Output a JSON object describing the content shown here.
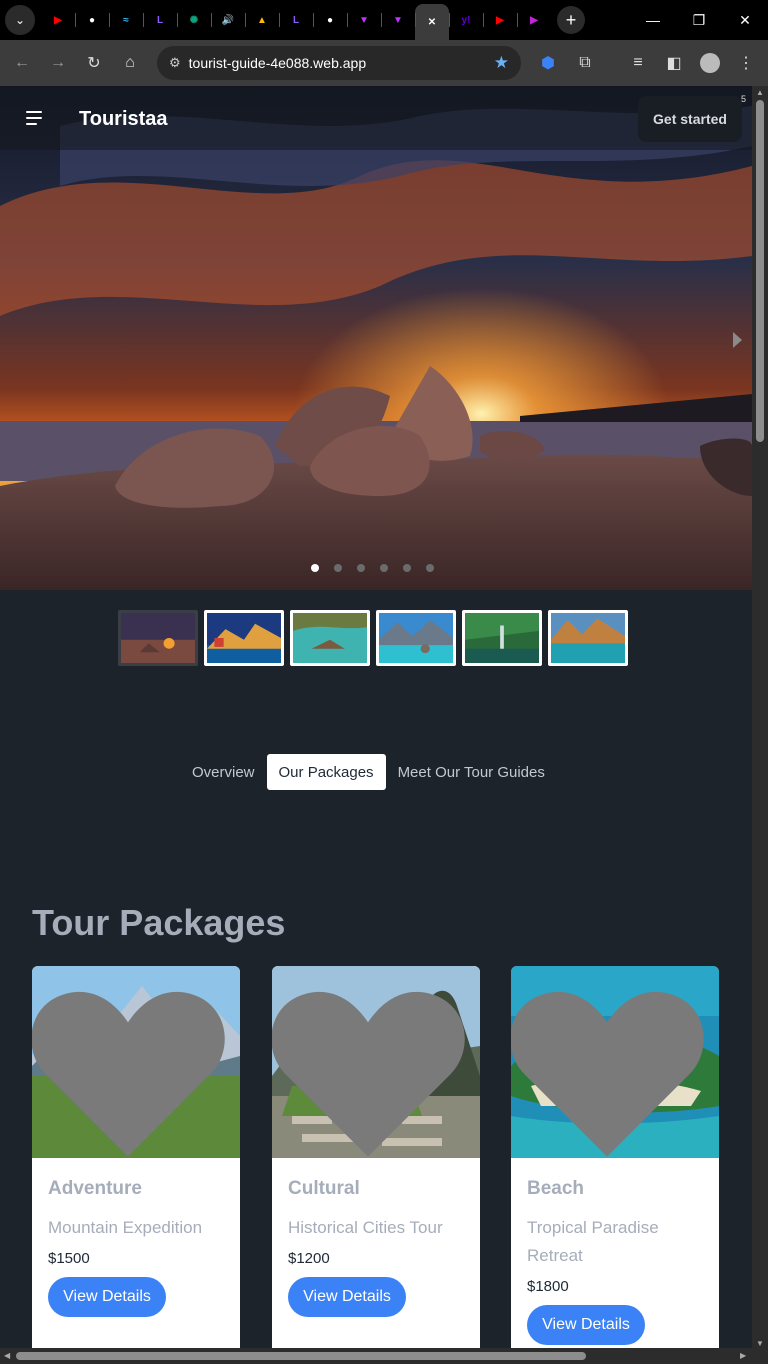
{
  "browser": {
    "url": "tourist-guide-4e088.web.app",
    "tabs": [
      {
        "icon": "youtube-icon",
        "color": "#ff0000",
        "glyph": "▶"
      },
      {
        "icon": "github-icon",
        "color": "#ffffff",
        "glyph": "●"
      },
      {
        "icon": "tailwind-icon",
        "color": "#38bdf8",
        "glyph": "≈"
      },
      {
        "icon": "lc-icon",
        "color": "#8b5cf6",
        "glyph": "L"
      },
      {
        "icon": "chatgpt-icon",
        "color": "#10a37f",
        "glyph": "✺"
      },
      {
        "icon": "speaker-icon",
        "color": "#ffffff",
        "glyph": "🔊"
      },
      {
        "icon": "drive-icon",
        "color": "#fbbc04",
        "glyph": "▲"
      },
      {
        "icon": "lc-icon",
        "color": "#8b5cf6",
        "glyph": "L"
      },
      {
        "icon": "github-icon",
        "color": "#ffffff",
        "glyph": "●"
      },
      {
        "icon": "vite-icon",
        "color": "#bd34fe",
        "glyph": "▼"
      },
      {
        "icon": "vite-icon",
        "color": "#bd34fe",
        "glyph": "▼"
      },
      {
        "icon": "close-icon",
        "color": "#ffffff",
        "glyph": "✕",
        "active": true
      },
      {
        "icon": "yahoo-icon",
        "color": "#6001d2",
        "glyph": "y!"
      },
      {
        "icon": "youtube-icon",
        "color": "#ff0000",
        "glyph": "▶"
      },
      {
        "icon": "play-icon",
        "color": "#c026d3",
        "glyph": "▶"
      }
    ]
  },
  "navbar": {
    "brand": "Touristaa",
    "cta": "Get started",
    "badge": "5"
  },
  "hero": {
    "slide_count": 6,
    "active_slide": 1
  },
  "tabs": {
    "items": [
      "Overview",
      "Our Packages",
      "Meet Our Tour Guides"
    ],
    "active": 1
  },
  "packages": {
    "title": "Tour Packages",
    "cards": [
      {
        "category": "Adventure",
        "name": "Mountain Expedition",
        "price": "$1500",
        "button": "View Details"
      },
      {
        "category": "Cultural",
        "name": "Historical Cities Tour",
        "price": "$1200",
        "button": "View Details"
      },
      {
        "category": "Beach",
        "name": "Tropical Paradise Retreat",
        "price": "$1800",
        "button": "View Details"
      }
    ]
  }
}
